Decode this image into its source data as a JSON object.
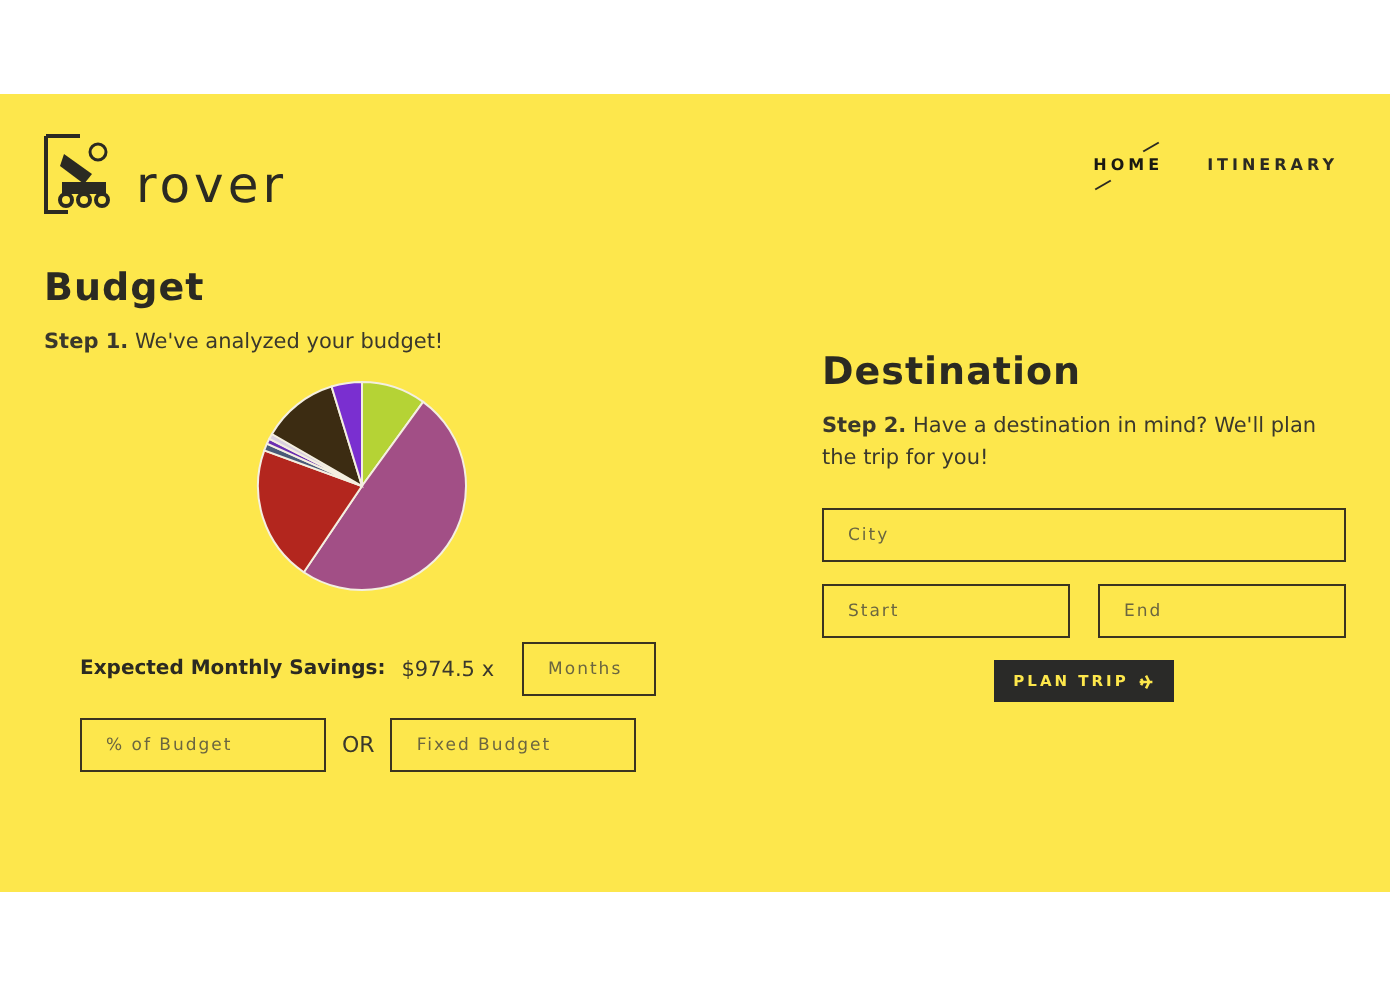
{
  "brand": {
    "name": "rover"
  },
  "nav": [
    {
      "label": "HOME",
      "selected": true
    },
    {
      "label": "ITINERARY",
      "selected": false
    }
  ],
  "budget": {
    "title": "Budget",
    "step": "**Step 1.** We've analyzed your budget!",
    "savings_label": "Expected Monthly Savings:",
    "savings_value": "$974.5 x",
    "months": {
      "placeholder": "Months"
    },
    "percent": {
      "placeholder": "% of Budget"
    },
    "or": "OR",
    "fixed": {
      "placeholder": "Fixed Budget"
    }
  },
  "destination": {
    "title": "Destination",
    "step": "**Step 2.** Have a destination in mind? We'll plan the trip for you!",
    "city": {
      "placeholder": "City"
    },
    "start": {
      "placeholder": "Start"
    },
    "end": {
      "placeholder": "End"
    },
    "button": "PLAN TRIP"
  }
}
